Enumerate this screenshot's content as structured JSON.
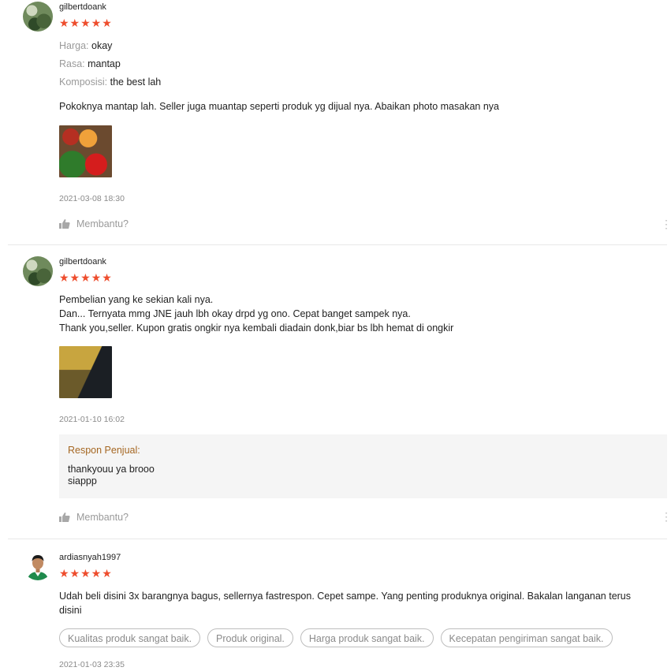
{
  "reviews": [
    {
      "username": "gilbertdoank",
      "stars": "★★★★★",
      "attributes": [
        {
          "key": "Harga:",
          "value": "okay"
        },
        {
          "key": "Rasa:",
          "value": "mantap"
        },
        {
          "key": "Komposisi:",
          "value": "the best lah"
        }
      ],
      "text": "Pokoknya mantap lah. Seller juga muantap seperti produk yg dijual nya. Abaikan photo masakan nya",
      "date": "2021-03-08 18:30",
      "helpful": "Membantu?"
    },
    {
      "username": "gilbertdoank",
      "stars": "★★★★★",
      "text_lines": [
        "Pembelian yang ke sekian kali nya.",
        "Dan... Ternyata mmg JNE jauh lbh okay drpd yg ono. Cepat banget sampek nya.",
        "Thank you,seller. Kupon gratis ongkir nya kembali diadain donk,biar bs lbh hemat di ongkir"
      ],
      "date": "2021-01-10 16:02",
      "seller_response": {
        "label": "Respon Penjual:",
        "lines": [
          "thankyouu ya brooo",
          "siappp"
        ]
      },
      "helpful": "Membantu?"
    },
    {
      "username": "ardiasnyah1997",
      "stars": "★★★★★",
      "text_lines": [
        "Udah beli disini 3x barangnya bagus, sellernya fastrespon. Cepet sampe. Yang penting produknya original. Bakalan langanan terus",
        "disini"
      ],
      "tags": [
        "Kualitas produk sangat baik.",
        "Produk original.",
        "Harga produk sangat baik.",
        "Kecepatan pengiriman sangat baik."
      ],
      "date": "2021-01-03 23:35"
    }
  ],
  "colors": {
    "star": "#ee4d2d",
    "seller_label": "#a56722"
  },
  "icons": {
    "helpful": "thumbs-up-icon",
    "more": "more-vertical-icon"
  }
}
